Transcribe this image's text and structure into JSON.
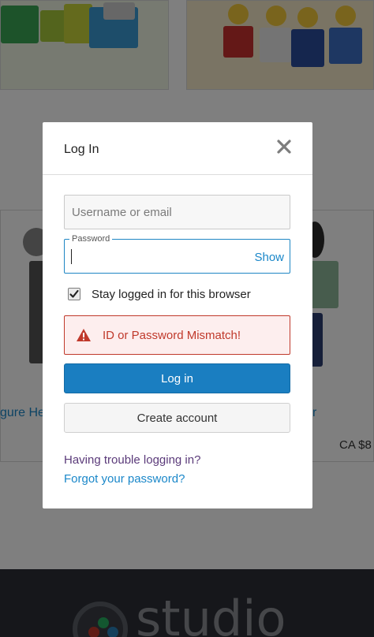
{
  "modal": {
    "title": "Log In",
    "username_placeholder": "Username or email",
    "password_label": "Password",
    "show_label": "Show",
    "stay_logged_in_label": "Stay logged in for this browser",
    "stay_logged_in_checked": true,
    "error_message": "ID or Password Mismatch!",
    "login_button": "Log in",
    "create_account_button": "Create account",
    "trouble_link": "Having trouble logging in?",
    "forgot_link": "Forgot your password?"
  },
  "background": {
    "left_product_link_fragment": "gure He",
    "right_product_link_fragment": "r",
    "right_price_fragment": "CA $8",
    "footer_brand_fragment": "studio"
  },
  "colors": {
    "primary": "#1a7ec1",
    "error": "#c0392b",
    "link": "#1a87c9",
    "visited_link": "#5b3b7a"
  },
  "icons": {
    "close": "close-icon",
    "warning": "warning-icon",
    "checkmark": "checkmark-icon"
  }
}
